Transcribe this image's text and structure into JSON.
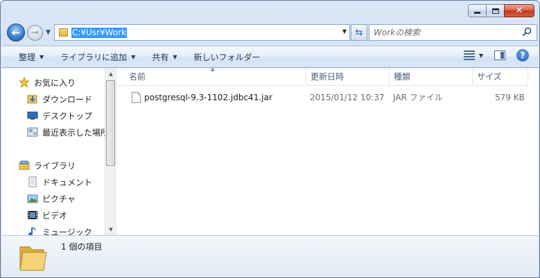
{
  "window": {
    "address_path": "C:¥Usr¥Work",
    "search_placeholder": "Workの検索"
  },
  "toolbar": {
    "organize_label": "整理",
    "add_to_library_label": "ライブラリに追加",
    "share_label": "共有",
    "new_folder_label": "新しいフォルダー"
  },
  "nav": {
    "favorites_label": "お気に入り",
    "favorites": [
      "ダウンロード",
      "デスクトップ",
      "最近表示した場所"
    ],
    "libraries_label": "ライブラリ",
    "libraries": [
      "ドキュメント",
      "ピクチャ",
      "ビデオ",
      "ミュージック"
    ]
  },
  "columns": {
    "name": "名前",
    "date_modified": "更新日時",
    "type": "種類",
    "size": "サイズ"
  },
  "files": [
    {
      "name": "postgresql-9.3-1102.jdbc41.jar",
      "date_modified": "2015/01/12 10:37",
      "type": "JAR ファイル",
      "size": "579 KB"
    }
  ],
  "details": {
    "item_count": "1 個の項目"
  },
  "colors": {
    "selection": "#3399ff",
    "chrome": "#c9daee",
    "close_button": "#c3391c"
  }
}
